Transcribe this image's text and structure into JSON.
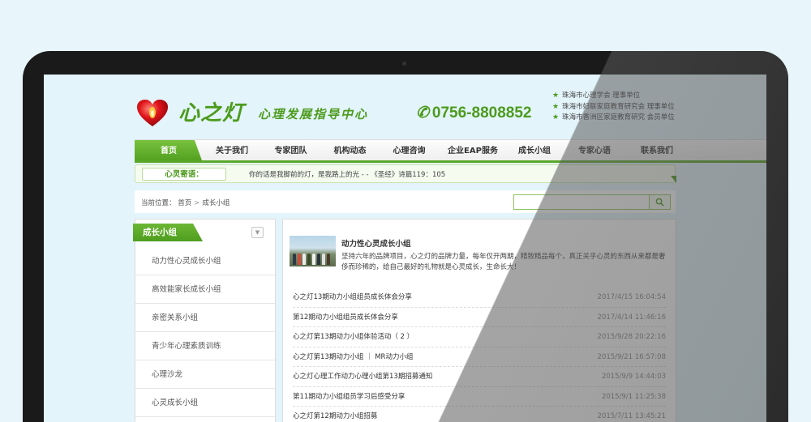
{
  "header": {
    "logo_name": "心之灯",
    "logo_sub": "心理发展指导中心",
    "phone": "0756-8808852",
    "roles": [
      "珠海市心理学会 理事单位",
      "珠海市妇联家庭教育研究会 理事单位",
      "珠海市香洲区家庭教育研究 会员单位"
    ]
  },
  "nav": {
    "items": [
      "首页",
      "关于我们",
      "专家团队",
      "机构动态",
      "心理咨询",
      "企业EAP服务",
      "成长小组",
      "专家心语",
      "联系我们"
    ],
    "active_index": 0
  },
  "motto": {
    "label": "心灵寄语：",
    "text": "你的话是我脚前的灯，是我路上的光 - - 《圣经》诗篇119：105"
  },
  "breadcrumb": {
    "prefix": "当前位置：",
    "home": "首页",
    "separator": ">",
    "current": "成长小组"
  },
  "search": {
    "placeholder": ""
  },
  "sidebar": {
    "title": "成长小组",
    "items": [
      "动力性心灵成长小组",
      "高效能家长成长小组",
      "亲密关系小组",
      "青少年心理素质训练",
      "心理沙龙",
      "心灵成长小组"
    ]
  },
  "feature": {
    "title": "动力性心灵成长小组",
    "desc": "坚持六年的品牌项目，心之灯的品牌力量，每年仅开两期，精致精品每个，真正关乎心灵的东西从来都是奢侈而珍稀的，给自己最好的礼物就是心灵成长，生命长大！"
  },
  "news": [
    {
      "title": "心之灯13期动力小组组员成长体会分享",
      "date": "2017/4/15 16:04:54"
    },
    {
      "title": "第12期动力小组组员成长体会分享",
      "date": "2017/4/14 11:46:16"
    },
    {
      "title": "心之灯第13期动力小组体验活动（ 2 ）",
      "date": "2015/9/28 20:22:16"
    },
    {
      "title": "心之灯第13期动力小组 ｜ MR动力小组",
      "date": "2015/9/21 16:57:08"
    },
    {
      "title": "心之灯心理工作动力心理小组第13期招募通知",
      "date": "2015/9/9 14:44:03"
    },
    {
      "title": "第11期动力小组组员学习后感受分享",
      "date": "2015/9/1 11:25:38"
    },
    {
      "title": "心之灯第12期动力小组招募",
      "date": "2015/7/11 13:45:21"
    }
  ],
  "colors": {
    "brand_green": "#4c9b1c",
    "nav_active": "#5aa82a",
    "heart_red": "#d9151b",
    "background": "#e8f5fb"
  },
  "icons": {
    "logo": "heart-lamp-icon",
    "phone": "phone-icon",
    "role_bullet": "star-icon",
    "search": "search-icon",
    "sidebar_toggle": "chevron-down-icon"
  }
}
